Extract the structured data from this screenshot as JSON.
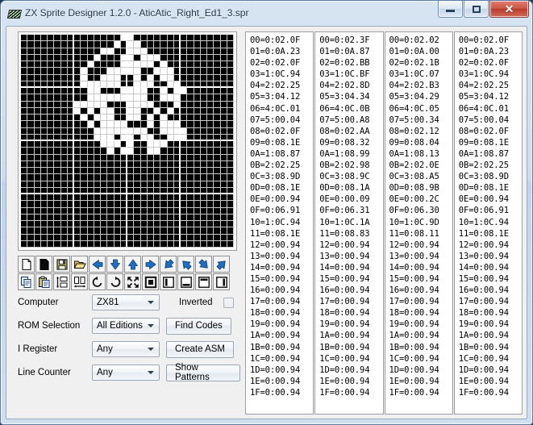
{
  "window": {
    "title": "ZX Sprite Designer 1.2.0 - AticAtic_Right_Ed1_3.spr",
    "app_icon": "zx-stripes-icon",
    "minimize_label": "–",
    "maximize_label": "□",
    "close_label": "✕"
  },
  "toolbar": {
    "row1": [
      {
        "name": "new-file-icon",
        "title": "New"
      },
      {
        "name": "file-icon",
        "title": "File"
      },
      {
        "name": "save-icon",
        "title": "Save"
      },
      {
        "name": "open-folder-icon",
        "title": "Open"
      },
      {
        "name": "arrow-left-icon",
        "title": "Shift Left"
      },
      {
        "name": "arrow-down-icon",
        "title": "Shift Down"
      },
      {
        "name": "arrow-up-icon",
        "title": "Shift Up"
      },
      {
        "name": "arrow-right-icon",
        "title": "Shift Right"
      },
      {
        "name": "arrow-down-right-icon",
        "title": "Shift Down Right"
      },
      {
        "name": "arrow-up-right-icon",
        "title": "Shift Up Right"
      },
      {
        "name": "arrow-down-left-icon",
        "title": "Shift Down Left"
      },
      {
        "name": "arrow-up-left-icon",
        "title": "Shift Up Left"
      }
    ],
    "row2": [
      {
        "name": "copy-icon",
        "title": "Copy"
      },
      {
        "name": "paste-icon",
        "title": "Paste"
      },
      {
        "name": "flip-vertical-icon",
        "title": "Flip Vertical"
      },
      {
        "name": "flip-horizontal-icon",
        "title": "Flip Horizontal"
      },
      {
        "name": "rotate-ccw-icon",
        "title": "Rotate Left"
      },
      {
        "name": "rotate-cw-icon",
        "title": "Rotate Right"
      },
      {
        "name": "expand-icon",
        "title": "Invert / Expand"
      },
      {
        "name": "square-outline-icon",
        "title": "Box"
      },
      {
        "name": "bar-left-icon",
        "title": "Left Edge"
      },
      {
        "name": "bar-bottom-icon",
        "title": "Bottom Edge"
      },
      {
        "name": "bar-top-icon",
        "title": "Top Edge"
      },
      {
        "name": "bar-right-icon",
        "title": "Right Edge"
      }
    ]
  },
  "form": {
    "computer": {
      "label": "Computer",
      "value": "ZX81"
    },
    "rom_selection": {
      "label": "ROM Selection",
      "value": "All Editions"
    },
    "i_register": {
      "label": "I Register",
      "value": "Any"
    },
    "line_counter": {
      "label": "Line Counter",
      "value": "Any"
    },
    "inverted": {
      "label": "Inverted",
      "checked": false
    },
    "find_codes_label": "Find Codes",
    "create_asm_label": "Create ASM",
    "show_patterns_label": "Show Patterns"
  },
  "sprite": {
    "cols": 32,
    "rows": 32,
    "rows_bits": [
      "00000000000000011000000000000000",
      "00000000000000101100000000000000",
      "00000000000011001110000000000000",
      "00000000000100011011100000000000",
      "00000000001000011111010000000000",
      "00000000010001111100111000000000",
      "00000000010011100101011000000000",
      "00000000011111100111001100000000",
      "00000000001100011110010110000000",
      "00000000001111111110011100000000",
      "00000000111110001111000100000000",
      "00000000101011001100101000000000",
      "00000000010111001101010000000000",
      "00000000001011110001011100000000",
      "00000000000111111110011110000000",
      "00000000000111011011001110000000",
      "00000000000011101001110000000000",
      "00000000000001011001100000000000",
      "00000000000000000000000000000000",
      "00000000000000000000000000000000",
      "00000000000000000000000000000000",
      "00000000000000000000000000000000",
      "00000000000000000000000000000000",
      "00000000000000000000000000000000",
      "00000000000000000000000000000000",
      "00000000000000000000000000000000",
      "00000000000000000000000000000000",
      "00000000000000000000000000000000",
      "00000000000000000000000000000000",
      "00000000000000000000000000000000",
      "00000000000000000000000000000000",
      "00000000000000000000000000000000"
    ]
  },
  "code_columns": [
    {
      "name": "code-column-1",
      "lines": [
        "00=0:02.0F",
        "01=0:0A.23",
        "02=0:02.0F",
        "03=1:0C.94",
        "04=2:02.25",
        "05=3:04.12",
        "06=4:0C.01",
        "07=5:00.04",
        "08=0:02.0F",
        "09=0:08.1E",
        "0A=1:08.87",
        "0B=2:02.25",
        "0C=3:08.9D",
        "0D=0:08.1E",
        "0E=0:00.94",
        "0F=0:06.91",
        "10=1:0C.94",
        "11=0:08.1E",
        "12=0:00.94",
        "13=0:00.94",
        "14=0:00.94",
        "15=0:00.94",
        "16=0:00.94",
        "17=0:00.94",
        "18=0:00.94",
        "19=0:00.94",
        "1A=0:00.94",
        "1B=0:00.94",
        "1C=0:00.94",
        "1D=0:00.94",
        "1E=0:00.94",
        "1F=0:00.94"
      ]
    },
    {
      "name": "code-column-2",
      "lines": [
        "00=0:02.3F",
        "01=0:0A.87",
        "02=0:02.BB",
        "03=1:0C.BF",
        "04=2:02.8D",
        "05=3:04.34",
        "06=4:0C.0B",
        "07=5:00.A8",
        "08=0:02.AA",
        "09=0:08.32",
        "0A=1:08.99",
        "0B=2:02.98",
        "0C=3:08.9C",
        "0D=0:08.1A",
        "0E=0:00.09",
        "0F=0:06.31",
        "10=1:0C.1A",
        "11=0:08.83",
        "12=0:00.94",
        "13=0:00.94",
        "14=0:00.94",
        "15=0:00.94",
        "16=0:00.94",
        "17=0:00.94",
        "18=0:00.94",
        "19=0:00.94",
        "1A=0:00.94",
        "1B=0:00.94",
        "1C=0:00.94",
        "1D=0:00.94",
        "1E=0:00.94",
        "1F=0:00.94"
      ]
    },
    {
      "name": "code-column-3",
      "lines": [
        "00=0:02.02",
        "01=0:0A.00",
        "02=0:02.1B",
        "03=1:0C.07",
        "04=2:02.B3",
        "05=3:04.29",
        "06=4:0C.05",
        "07=5:00.34",
        "08=0:02.12",
        "09=0:08.04",
        "0A=1:08.13",
        "0B=2:02.0E",
        "0C=3:08.A5",
        "0D=0:08.9B",
        "0E=0:00.2C",
        "0F=0:06.30",
        "10=1:0C.9D",
        "11=0:08.11",
        "12=0:00.94",
        "13=0:00.94",
        "14=0:00.94",
        "15=0:00.94",
        "16=0:00.94",
        "17=0:00.94",
        "18=0:00.94",
        "19=0:00.94",
        "1A=0:00.94",
        "1B=0:00.94",
        "1C=0:00.94",
        "1D=0:00.94",
        "1E=0:00.94",
        "1F=0:00.94"
      ]
    },
    {
      "name": "code-column-4",
      "lines": [
        "00=0:02.0F",
        "01=0:0A.23",
        "02=0:02.0F",
        "03=1:0C.94",
        "04=2:02.25",
        "05=3:04.12",
        "06=4:0C.01",
        "07=5:00.04",
        "08=0:02.0F",
        "09=0:08.1E",
        "0A=1:08.87",
        "0B=2:02.25",
        "0C=3:08.9D",
        "0D=0:08.1E",
        "0E=0:00.94",
        "0F=0:06.91",
        "10=1:0C.94",
        "11=0:08.1E",
        "12=0:00.94",
        "13=0:00.94",
        "14=0:00.94",
        "15=0:00.94",
        "16=0:00.94",
        "17=0:00.94",
        "18=0:00.94",
        "19=0:00.94",
        "1A=0:00.94",
        "1B=0:00.94",
        "1C=0:00.94",
        "1D=0:00.94",
        "1E=0:00.94",
        "1F=0:00.94"
      ]
    }
  ],
  "colors": {
    "titlebar_text": "#23364c",
    "close_button": "#b93b2c",
    "arrow_blue": "#1f6fc4",
    "grid_on": "#ffffff",
    "grid_off": "#000000",
    "client_bg": "#f0f0f0"
  }
}
